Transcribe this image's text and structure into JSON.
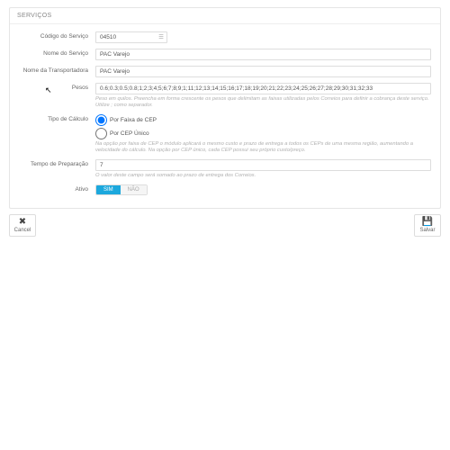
{
  "panel": {
    "title": "SERVIÇOS"
  },
  "fields": {
    "codigo_label": "Código do Serviço",
    "codigo_value": "04510",
    "nome_label": "Nome do Serviço",
    "nome_value": "PAC Varejo",
    "transp_label": "Nome da Transportadora",
    "transp_value": "PAC Varejo",
    "pesos_label": "Pesos",
    "pesos_value": "0.6;0.3;0.5;0.8;1;2;3;4;5;6;7;8;9;1;11;12;13;14;15;16;17;18;19;20;21;22;23;24;25;26;27;28;29;30;31;32;33",
    "pesos_help": "Peso em quilos. Preencha em forma crescente os pesos que delimitam as faixas utilizadas pelos Correios para definir a cobrança deste serviço. Utilize ; como separador.",
    "tipo_label": "Tipo de Cálculo",
    "tipo_opt1": "Por Faixa de CEP",
    "tipo_opt2": "Por CEP Único",
    "tipo_help": "Na opção por faixa de CEP o módulo aplicará o mesmo custo e prazo de entrega a todos os CEPs de uma mesma região, aumentando a velocidade do cálculo. Na opção por CEP único, cada CEP possui seu próprio custo/preço.",
    "tempo_label": "Tempo de Preparação",
    "tempo_value": "7",
    "tempo_help": "O valor deste campo será somado ao prazo de entrega dos Correios.",
    "ativo_label": "Ativo",
    "ativo_on": "SIM",
    "ativo_off": "NÃO"
  },
  "footer": {
    "cancel": "Cancel",
    "save": "Salvar"
  }
}
